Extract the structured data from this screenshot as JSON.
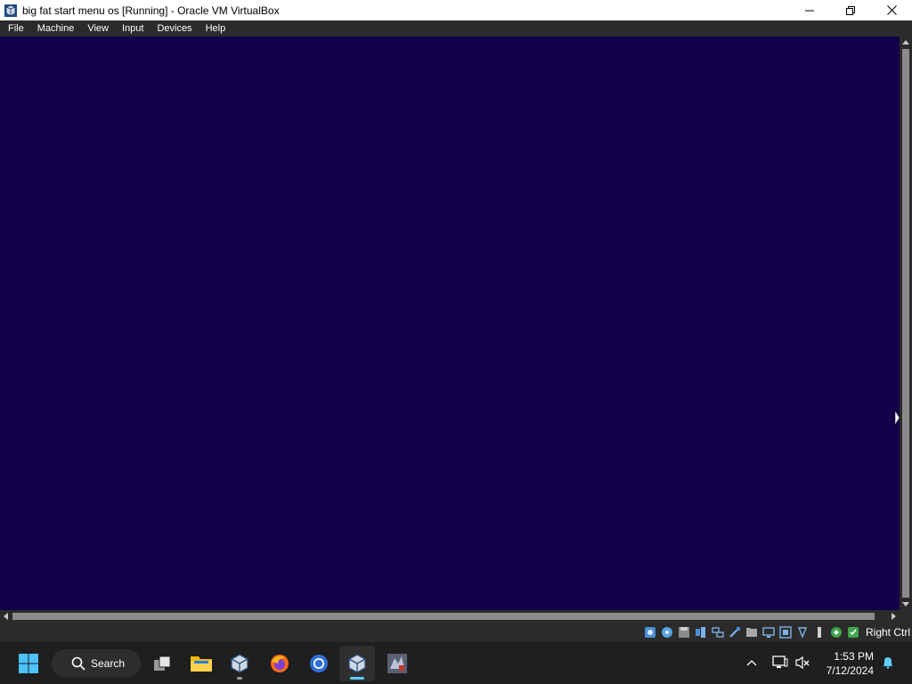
{
  "window": {
    "title": "big fat start menu os [Running] - Oracle VM VirtualBox",
    "controls": [
      "minimize",
      "maximize",
      "close"
    ]
  },
  "menubar": {
    "items": [
      "File",
      "Machine",
      "View",
      "Input",
      "Devices",
      "Help"
    ]
  },
  "vm": {
    "background_color": "#13004a"
  },
  "statusbar": {
    "icons": [
      "hard-disk-icon",
      "optical-drive-icon",
      "floppy-icon",
      "audio-icon",
      "network-icon",
      "usb-icon",
      "shared-folders-icon",
      "display-icon",
      "video-capture-icon",
      "recording-icon",
      "cpu-icon",
      "mouse-integration-icon",
      "keyboard-icon"
    ],
    "host_key": "Right Ctrl"
  },
  "taskbar": {
    "search_label": "Search",
    "apps": [
      "start-button",
      "task-view",
      "file-explorer",
      "virtualbox-manager",
      "firefox",
      "chrome",
      "virtualbox-vm",
      "game-app"
    ],
    "clock_time": "1:53 PM",
    "clock_date": "7/12/2024"
  },
  "colors": {
    "titlebar_bg": "#ffffff",
    "menubar_bg": "#2b2b2b",
    "taskbar_bg": "#1f1f1f",
    "accent": "#60cdff"
  }
}
